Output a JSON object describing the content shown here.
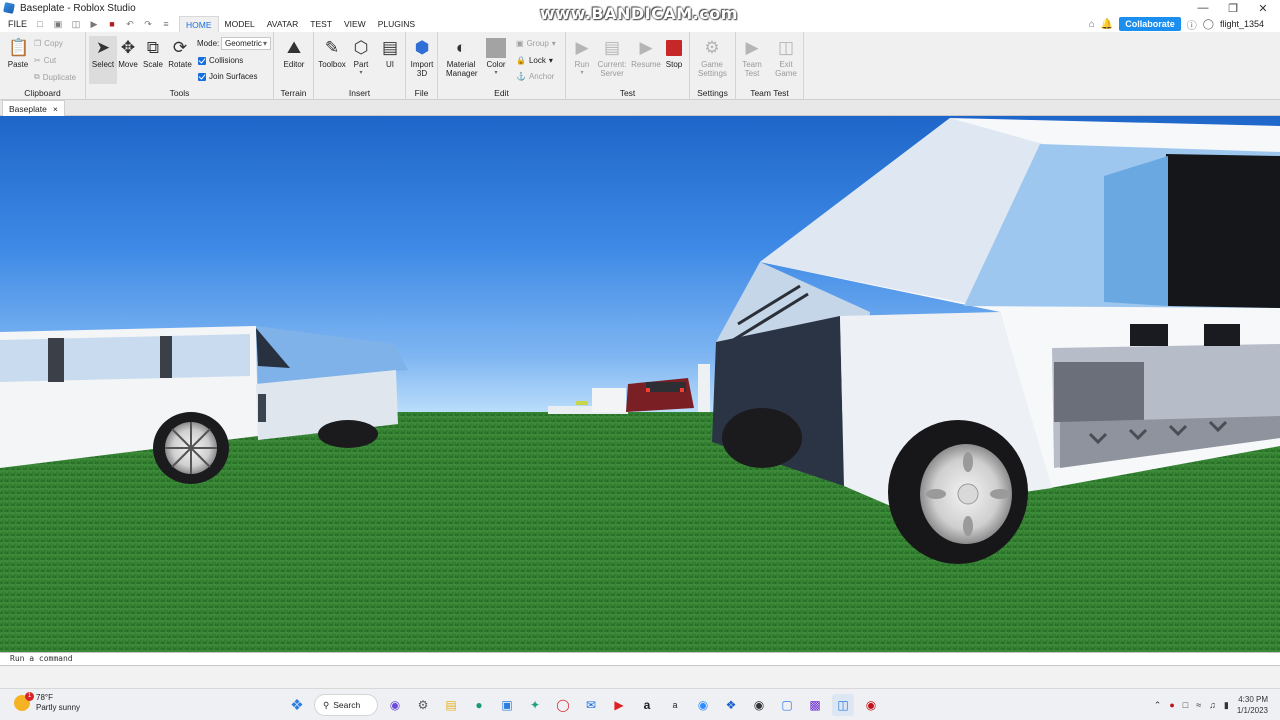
{
  "window": {
    "title": "Baseplate - Roblox Studio",
    "watermark": "www.BANDICAM.com"
  },
  "menu": {
    "file": "FILE",
    "tabs": [
      "HOME",
      "MODEL",
      "AVATAR",
      "TEST",
      "VIEW",
      "PLUGINS"
    ],
    "active_tab": "HOME",
    "collaborate": "Collaborate",
    "user": "flight_1354"
  },
  "ribbon": {
    "clipboard": {
      "label": "Clipboard",
      "paste": "Paste",
      "copy": "Copy",
      "cut": "Cut",
      "duplicate": "Duplicate"
    },
    "tools": {
      "label": "Tools",
      "select": "Select",
      "move": "Move",
      "scale": "Scale",
      "rotate": "Rotate",
      "mode_label": "Mode:",
      "mode_value": "Geometric",
      "collisions": "Collisions",
      "join_surfaces": "Join Surfaces"
    },
    "terrain": {
      "label": "Terrain",
      "editor": "Editor"
    },
    "insert": {
      "label": "Insert",
      "toolbox": "Toolbox",
      "part": "Part",
      "ui": "UI"
    },
    "file": {
      "label": "File",
      "import_3d_line1": "Import",
      "import_3d_line2": "3D"
    },
    "edit": {
      "label": "Edit",
      "material_line1": "Material",
      "material_line2": "Manager",
      "color": "Color",
      "group": "Group",
      "lock": "Lock",
      "anchor": "Anchor"
    },
    "test": {
      "label": "Test",
      "run": "Run",
      "current_line1": "Current:",
      "current_line2": "Server",
      "resume": "Resume",
      "stop": "Stop"
    },
    "settings": {
      "label": "Settings",
      "game_line1": "Game",
      "game_line2": "Settings"
    },
    "team_test": {
      "label": "Team Test",
      "team_line1": "Team",
      "team_line2": "Test",
      "exit_line1": "Exit",
      "exit_line2": "Game"
    }
  },
  "document_tab": {
    "name": "Baseplate",
    "close": "×"
  },
  "command_bar": {
    "placeholder": "Run a command"
  },
  "taskbar": {
    "weather_temp": "78°F",
    "weather_desc": "Partly sunny",
    "weather_badge": "1",
    "search": "Search",
    "time": "4:30 PM",
    "date": "1/1/2023"
  },
  "colors": {
    "accent": "#1a6fe0",
    "collaborate": "#1a8ff0",
    "stop": "#c62828",
    "grass": "#2f7a2d"
  }
}
